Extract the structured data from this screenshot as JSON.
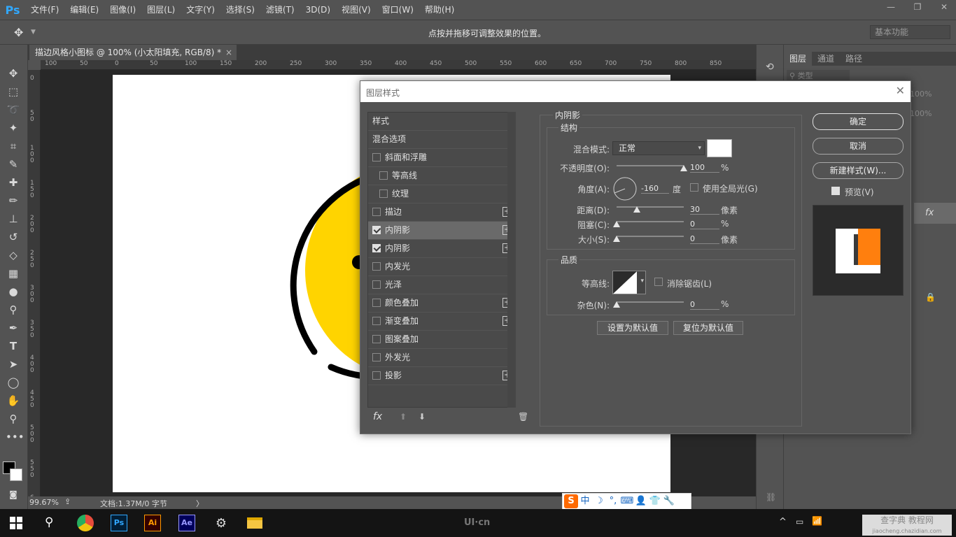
{
  "app": {
    "logo": "Ps",
    "menu": [
      "文件(F)",
      "编辑(E)",
      "图像(I)",
      "图层(L)",
      "文字(Y)",
      "选择(S)",
      "滤镜(T)",
      "3D(D)",
      "视图(V)",
      "窗口(W)",
      "帮助(H)"
    ],
    "window_controls": [
      "—",
      "❐",
      "✕"
    ]
  },
  "options_bar": {
    "hint": "点按并拖移可调整效果的位置。",
    "workspace": "基本功能"
  },
  "document": {
    "tab_title": "描边风格小图标 @ 100% (小太阳填充, RGB/8) *",
    "tab_close": "×",
    "ruler_h": [
      "100",
      "50",
      "0",
      "50",
      "100",
      "150",
      "200",
      "250",
      "300",
      "350",
      "400",
      "450",
      "500",
      "550",
      "600",
      "650",
      "700",
      "750",
      "800",
      "850"
    ],
    "ruler_v": [
      "0",
      "50",
      "100",
      "150",
      "200",
      "250",
      "300",
      "350",
      "400",
      "450",
      "500",
      "550",
      "600"
    ],
    "colors": {
      "sun_fill": "#ffd400",
      "stroke": "#000000",
      "artboard": "#ffffff"
    }
  },
  "status": {
    "zoom": "99.67%",
    "doc_info": "文档:1.37M/0 字节",
    "arrow": "〉"
  },
  "panel": {
    "tabs": [
      "图层",
      "通道",
      "路径"
    ],
    "search_placeholder": "类型",
    "opacity": "100%",
    "fill": "100%"
  },
  "dialog": {
    "title": "图层样式",
    "close": "✕",
    "list": [
      {
        "label": "样式",
        "checkbox": false,
        "checked": false,
        "plus": false,
        "indent": 0
      },
      {
        "label": "混合选项",
        "checkbox": false,
        "checked": false,
        "plus": false,
        "indent": 0
      },
      {
        "label": "斜面和浮雕",
        "checkbox": true,
        "checked": false,
        "plus": false,
        "indent": 0
      },
      {
        "label": "等高线",
        "checkbox": true,
        "checked": false,
        "plus": false,
        "indent": 1
      },
      {
        "label": "纹理",
        "checkbox": true,
        "checked": false,
        "plus": false,
        "indent": 1
      },
      {
        "label": "描边",
        "checkbox": true,
        "checked": false,
        "plus": true,
        "indent": 0
      },
      {
        "label": "内阴影",
        "checkbox": true,
        "checked": true,
        "plus": true,
        "indent": 0,
        "selected": true
      },
      {
        "label": "内阴影",
        "checkbox": true,
        "checked": true,
        "plus": true,
        "indent": 0
      },
      {
        "label": "内发光",
        "checkbox": true,
        "checked": false,
        "plus": false,
        "indent": 0
      },
      {
        "label": "光泽",
        "checkbox": true,
        "checked": false,
        "plus": false,
        "indent": 0
      },
      {
        "label": "颜色叠加",
        "checkbox": true,
        "checked": false,
        "plus": true,
        "indent": 0
      },
      {
        "label": "渐变叠加",
        "checkbox": true,
        "checked": false,
        "plus": true,
        "indent": 0
      },
      {
        "label": "图案叠加",
        "checkbox": true,
        "checked": false,
        "plus": false,
        "indent": 0
      },
      {
        "label": "外发光",
        "checkbox": true,
        "checked": false,
        "plus": false,
        "indent": 0
      },
      {
        "label": "投影",
        "checkbox": true,
        "checked": false,
        "plus": true,
        "indent": 0
      }
    ],
    "footer": {
      "fx": "fx",
      "up": "⬆",
      "down": "⬇",
      "trash": "🗑"
    },
    "section_title": "内阴影",
    "structure": {
      "title": "结构",
      "blend_label": "混合模式:",
      "blend_value": "正常",
      "shadow_color": "#ffffff",
      "opacity_label": "不透明度(O):",
      "opacity_value": "100",
      "opacity_unit": "%",
      "opacity_level": 1.0,
      "angle_label": "角度(A):",
      "angle_value": "-160",
      "angle_unit": "度",
      "global_light_label": "使用全局光(G)",
      "distance_label": "距离(D):",
      "distance_value": "30",
      "distance_unit": "像素",
      "distance_level": 0.3,
      "choke_label": "阻塞(C):",
      "choke_value": "0",
      "choke_unit": "%",
      "choke_level": 0,
      "size_label": "大小(S):",
      "size_value": "0",
      "size_unit": "像素",
      "size_level": 0
    },
    "quality": {
      "title": "品质",
      "contour_label": "等高线:",
      "antialias_label": "消除锯齿(L)",
      "noise_label": "杂色(N):",
      "noise_value": "0",
      "noise_unit": "%",
      "noise_level": 0
    },
    "make_default": "设置为默认值",
    "reset_default": "复位为默认值",
    "ok": "确定",
    "cancel": "取消",
    "new_style": "新建样式(W)...",
    "preview_label": "预览(V)",
    "preview_checked": true,
    "preview_colors": {
      "bg": "#2b2b2b",
      "card": "#ffffff",
      "accent": "#ff7f0e",
      "dark": "#3a3a3a"
    }
  },
  "ime": {
    "items": [
      "S",
      "中",
      "☽",
      "°,",
      "⌨",
      "👤",
      "👕",
      "🔧"
    ]
  },
  "taskbar": {
    "apps": [
      "Ps",
      "Ai",
      "Ae"
    ],
    "watermark": "UI·cn",
    "tray_watermark": "查字典 教程网",
    "tray_url": "jiaocheng.chazidian.com"
  }
}
